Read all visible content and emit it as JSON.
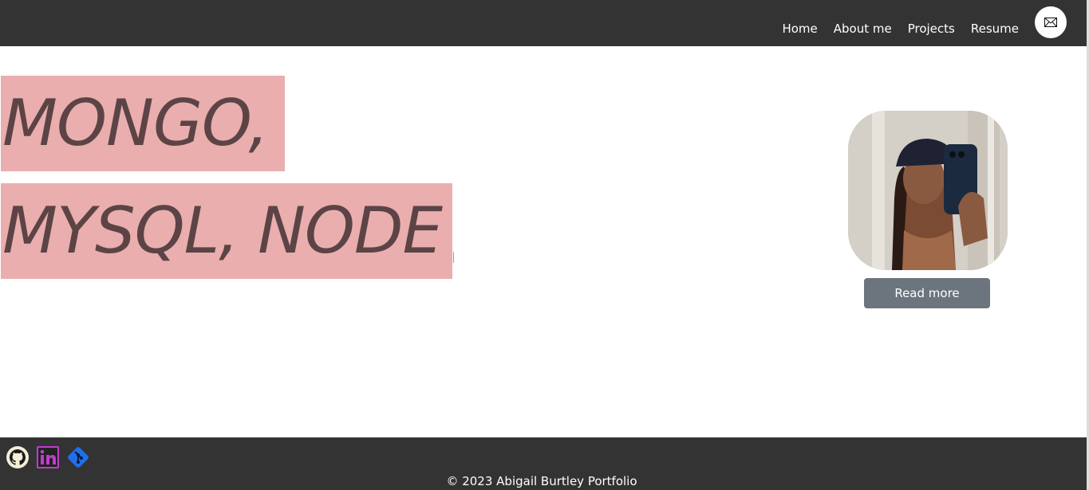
{
  "header": {
    "nav": [
      {
        "label": "Home"
      },
      {
        "label": "About me"
      },
      {
        "label": "Projects"
      },
      {
        "label": "Resume"
      }
    ],
    "mail_icon": "envelope-icon"
  },
  "hero": {
    "line1": "MONGO,",
    "line2": "MYSQL, NODE"
  },
  "profile": {
    "photo": "portrait-photo",
    "read_more_label": "Read more"
  },
  "footer": {
    "social_icons": [
      "github-icon",
      "linkedin-icon",
      "git-icon"
    ],
    "copyright": "© 2023 Abigail Burtley Portfolio"
  },
  "colors": {
    "bar_bg": "#333333",
    "hero_highlight": "#eaaeae",
    "hero_text": "#5c4446",
    "button_bg": "#6c757d",
    "linkedin": "#c13ccf",
    "git": "#1f6feb"
  }
}
